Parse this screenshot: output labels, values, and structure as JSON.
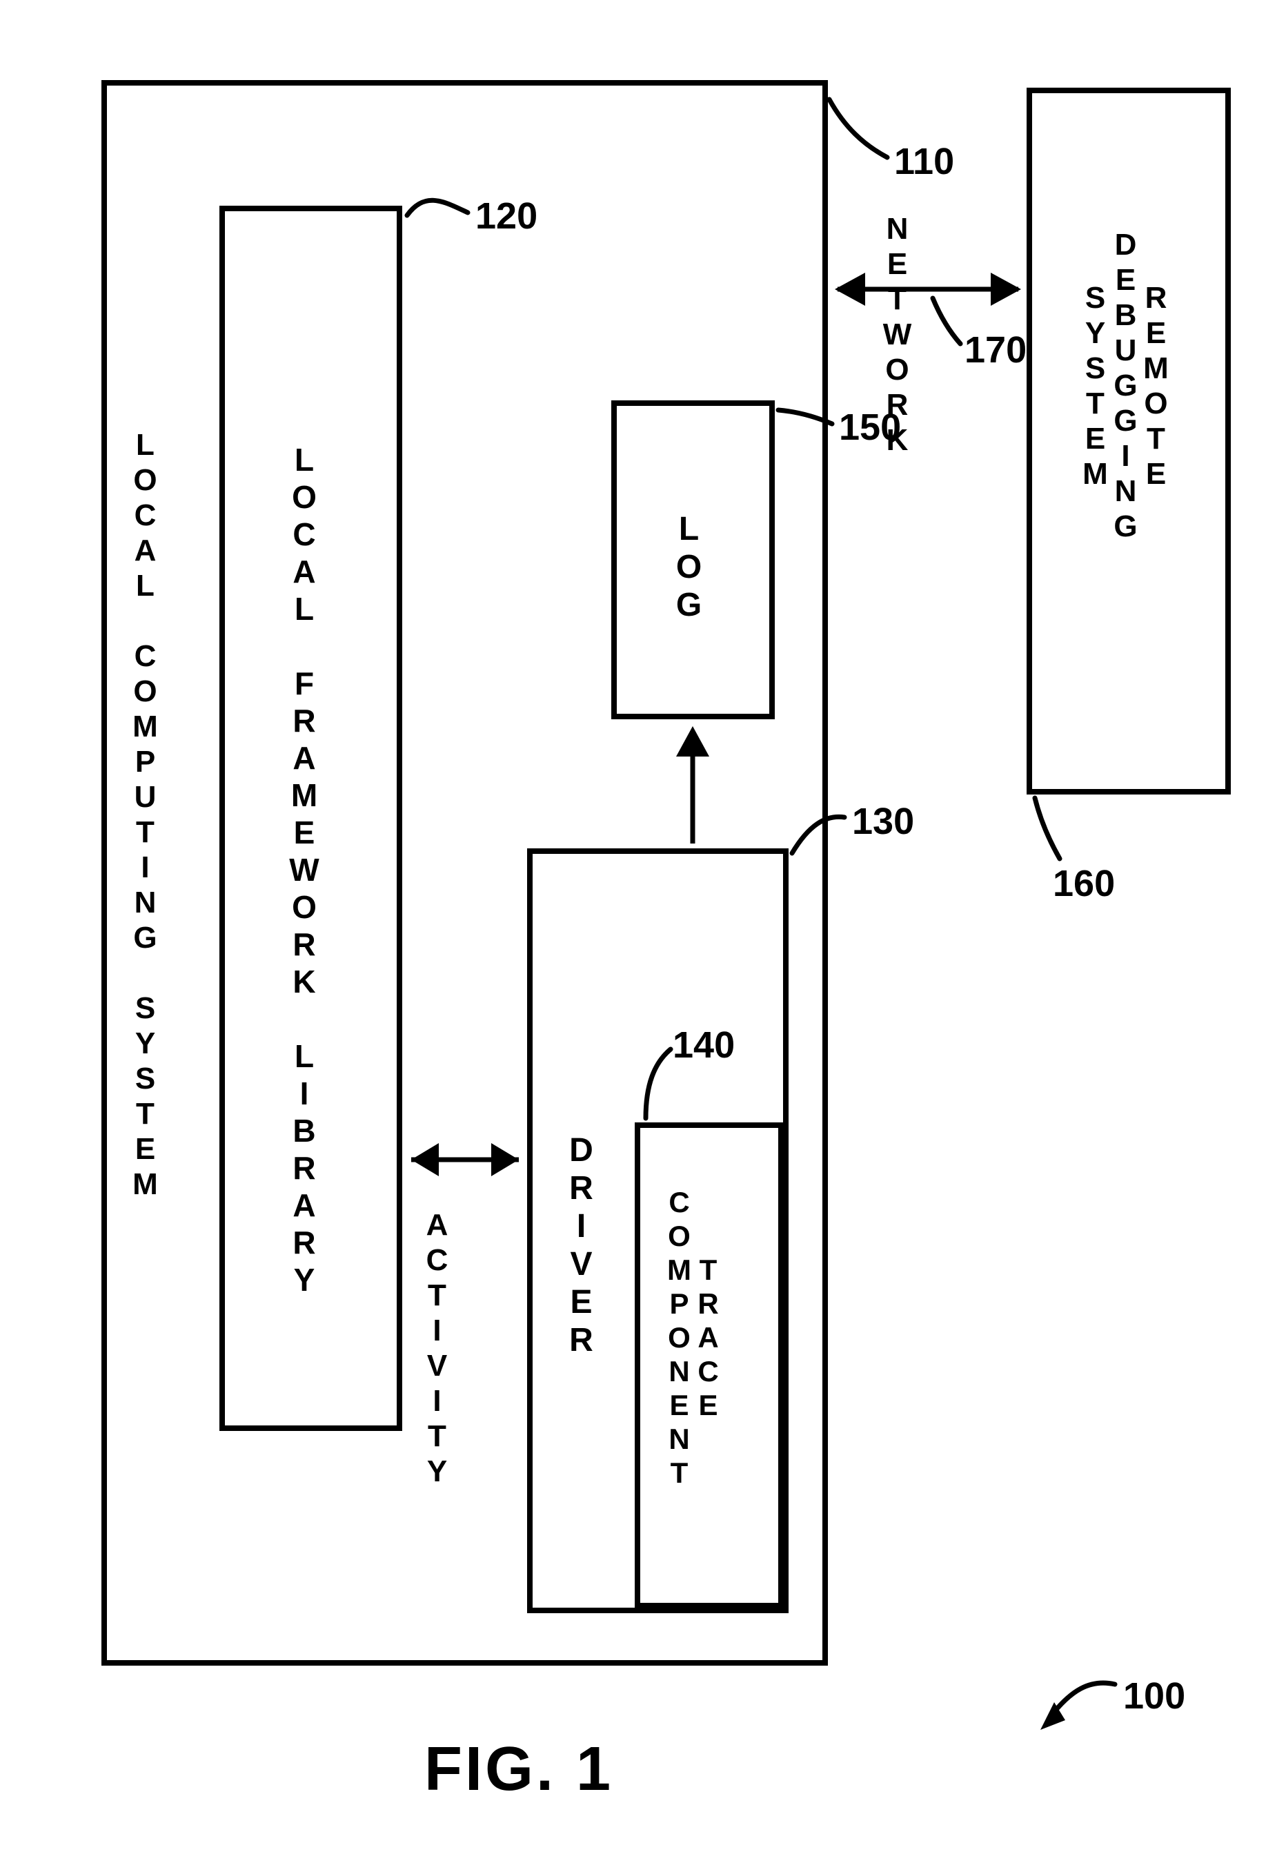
{
  "figure_label": "FIG. 1",
  "refs": {
    "system": "100",
    "local_computing_system": "110",
    "local_framework_library": "120",
    "driver": "130",
    "trace_component": "140",
    "log": "150",
    "remote_debugging_system": "160",
    "network": "170"
  },
  "blocks": {
    "local_computing_system_title": "LOCAL COMPUTING SYSTEM",
    "local_framework_library": "LOCAL FRAMEWORK LIBRARY",
    "activity": "ACTIVITY",
    "driver": "DRIVER",
    "trace_component": "TRACE\nCOMPONENT",
    "log": "LOG",
    "network": "NETWORK",
    "remote_debugging_system": "REMOTE\nDEBUGGING\nSYSTEM"
  }
}
